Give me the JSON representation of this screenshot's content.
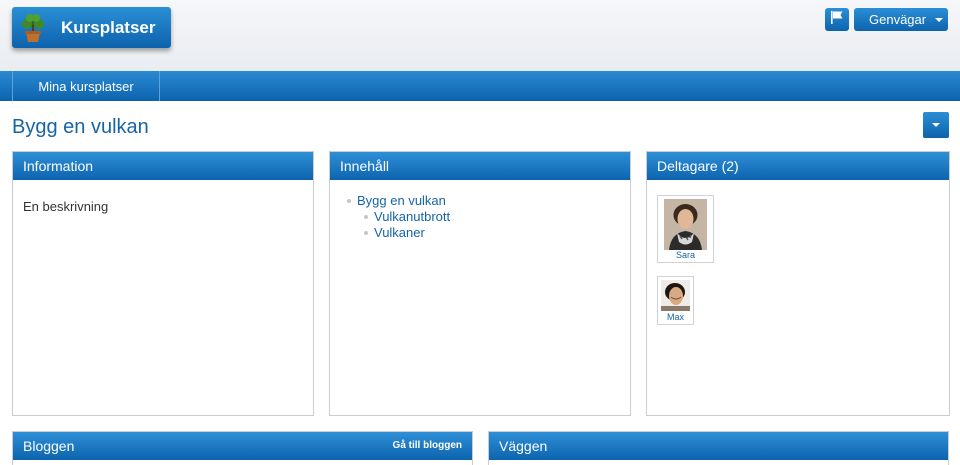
{
  "app": {
    "title": "Kursplatser"
  },
  "header": {
    "shortcuts_label": "Genvägar"
  },
  "nav": {
    "tabs": [
      {
        "label": "Mina kursplatser"
      }
    ]
  },
  "page": {
    "title": "Bygg en vulkan"
  },
  "panels": {
    "information": {
      "title": "Information",
      "text": "En beskrivning"
    },
    "content": {
      "title": "Innehåll",
      "root": "Bygg en vulkan",
      "children": [
        "Vulkanutbrott",
        "Vulkaner"
      ]
    },
    "participants": {
      "title": "Deltagare (2)",
      "members": [
        {
          "name": "Sara"
        },
        {
          "name": "Max"
        }
      ]
    },
    "blog": {
      "title": "Bloggen",
      "link": "Gå till bloggen"
    },
    "wall": {
      "title": "Väggen"
    }
  },
  "colors": {
    "primary": "#0d63ad",
    "link": "#1565a6"
  },
  "icons": [
    "tree-logo-icon",
    "flag-icon",
    "chevron-down-icon"
  ]
}
